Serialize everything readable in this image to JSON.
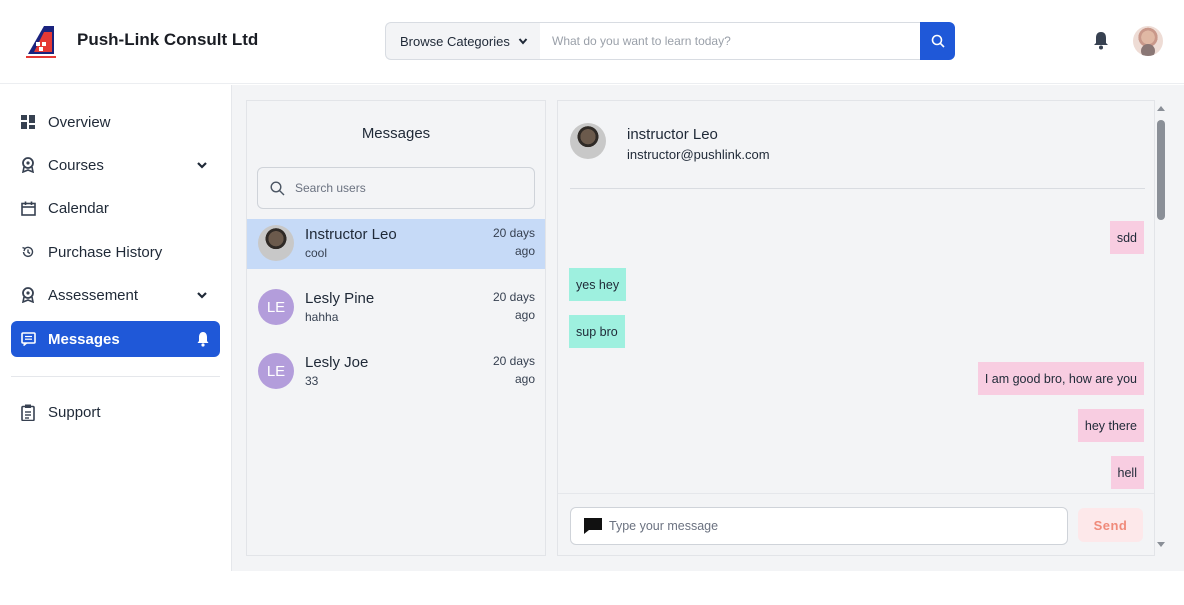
{
  "header": {
    "brand": "Push-Link Consult Ltd",
    "browse_label": "Browse Categories",
    "search_placeholder": "What do you want to learn today?",
    "accent": "#1f58d8"
  },
  "sidebar": {
    "items": [
      {
        "label": "Overview",
        "icon": "grid-icon"
      },
      {
        "label": "Courses",
        "icon": "award-icon",
        "has_chevron": true
      },
      {
        "label": "Calendar",
        "icon": "calendar-icon"
      },
      {
        "label": "Purchase History",
        "icon": "history-icon"
      },
      {
        "label": "Assessement",
        "icon": "award-icon",
        "has_chevron": true
      },
      {
        "label": "Messages",
        "icon": "message-icon",
        "active": true
      },
      {
        "label": "Support",
        "icon": "clipboard-icon"
      }
    ]
  },
  "conversations": {
    "title": "Messages",
    "search_placeholder": "Search users",
    "items": [
      {
        "name": "Instructor Leo",
        "last": "cool",
        "time": "20 days ago",
        "selected": true
      },
      {
        "name": "Lesly Pine",
        "last": "hahha",
        "time": "20 days ago",
        "initials": "LE"
      },
      {
        "name": "Lesly Joe",
        "last": "33",
        "time": "20 days ago",
        "initials": "LE"
      }
    ]
  },
  "chat": {
    "name": "instructor Leo",
    "email": "instructor@pushlink.com",
    "messages": [
      {
        "text": "sdd",
        "direction": "out"
      },
      {
        "text": "yes hey",
        "direction": "in"
      },
      {
        "text": "sup bro",
        "direction": "in"
      },
      {
        "text": "I am good bro, how are you",
        "direction": "out"
      },
      {
        "text": "hey there",
        "direction": "out"
      },
      {
        "text": "hell",
        "direction": "out"
      }
    ],
    "input_placeholder": "Type your message",
    "send_label": "Send",
    "colors": {
      "outgoing": "#f8cde1",
      "incoming": "#9ef0df"
    }
  }
}
